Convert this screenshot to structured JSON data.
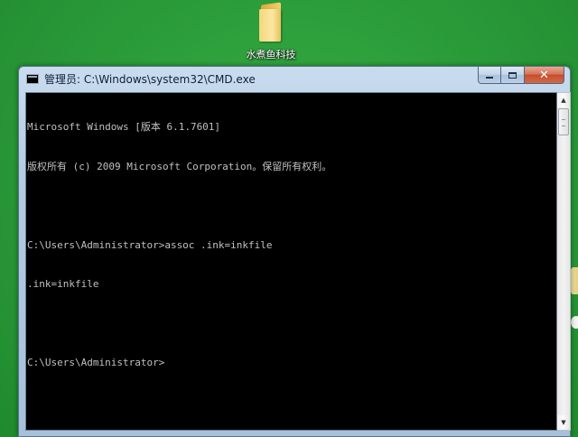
{
  "desktop": {
    "icon_label": "水煮鱼科技"
  },
  "window": {
    "title": "管理员: C:\\Windows\\system32\\CMD.exe",
    "controls": {
      "close_label": "✕"
    }
  },
  "console": {
    "lines": [
      "Microsoft Windows [版本 6.1.7601]",
      "版权所有 (c) 2009 Microsoft Corporation。保留所有权利。",
      "",
      "C:\\Users\\Administrator>assoc .ink=inkfile",
      ".ink=inkfile",
      "",
      "C:\\Users\\Administrator>"
    ]
  },
  "colors": {
    "desktop_bg": "#2a9a3a",
    "console_bg": "#000000",
    "console_fg": "#c0c0c0"
  }
}
